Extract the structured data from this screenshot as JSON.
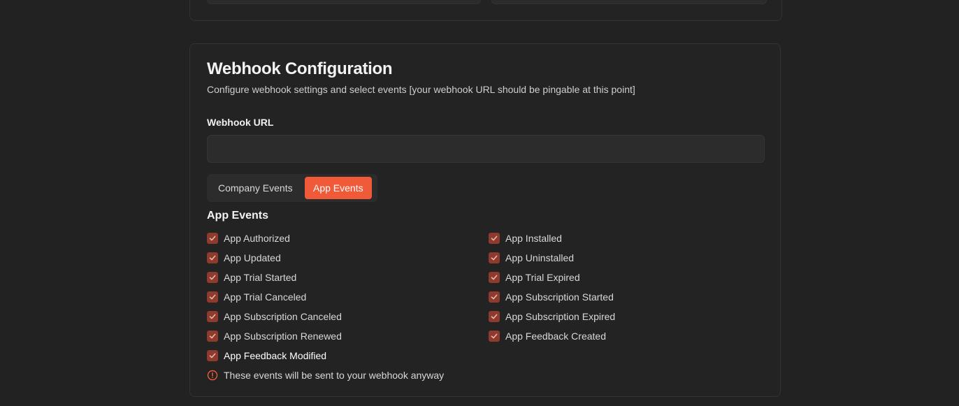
{
  "card": {
    "title": "Webhook Configuration",
    "description": "Configure webhook settings and select events [your webhook URL should be pingable at this point]"
  },
  "webhook": {
    "label": "Webhook URL",
    "value": "",
    "placeholder": ""
  },
  "tabs": [
    {
      "label": "Company Events",
      "active": false
    },
    {
      "label": "App Events",
      "active": true
    }
  ],
  "section_title": "App Events",
  "events": [
    {
      "label": "App Authorized",
      "checked": true
    },
    {
      "label": "App Installed",
      "checked": true
    },
    {
      "label": "App Updated",
      "checked": true
    },
    {
      "label": "App Uninstalled",
      "checked": true
    },
    {
      "label": "App Trial Started",
      "checked": true
    },
    {
      "label": "App Trial Expired",
      "checked": true
    },
    {
      "label": "App Trial Canceled",
      "checked": true
    },
    {
      "label": "App Subscription Started",
      "checked": true
    },
    {
      "label": "App Subscription Canceled",
      "checked": true
    },
    {
      "label": "App Subscription Expired",
      "checked": true
    },
    {
      "label": "App Subscription Renewed",
      "checked": true
    },
    {
      "label": "App Feedback Created",
      "checked": true
    },
    {
      "label": "App Feedback Modified",
      "checked": true
    }
  ],
  "notice": {
    "icon": "info-circle-icon",
    "text": "These events will be sent to your webhook anyway"
  },
  "colors": {
    "accent": "#f15a38",
    "checkbox": "#8e3a2c",
    "background": "#222222",
    "card": "#232323"
  }
}
